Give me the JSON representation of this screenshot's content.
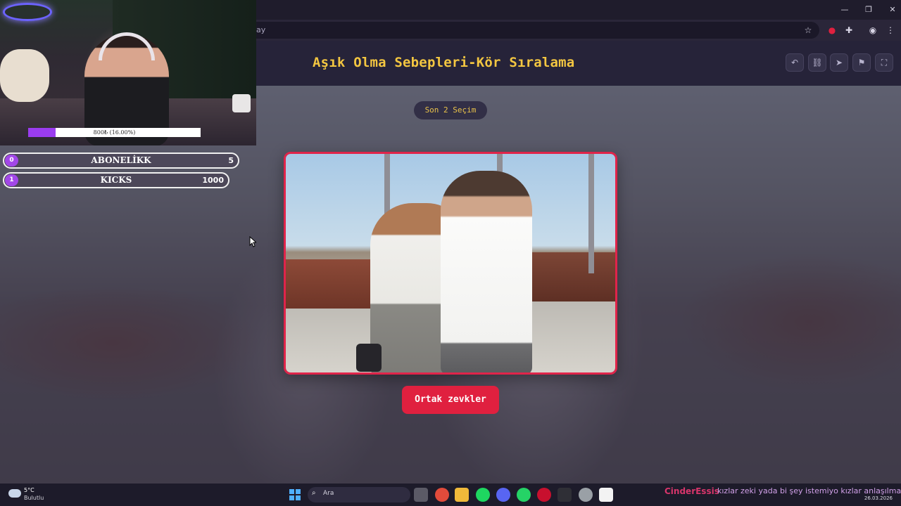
{
  "browser": {
    "url_fragment": "ay",
    "window_controls": [
      "minimize",
      "maximize",
      "close"
    ]
  },
  "app": {
    "title": "Aşık Olma Sebepleri-Kör Sıralama",
    "last_choices_label": "Son 2 Seçim",
    "choice_button_label": "Ortak zevkler",
    "header_buttons": [
      "undo-icon",
      "link-icon",
      "send-icon",
      "flag-icon",
      "fullscreen-icon"
    ],
    "accent_color": "#e0203f",
    "title_color": "#f3c641"
  },
  "stream": {
    "goal_text": "800₺ (16.00%)",
    "goal_progress": 0.16,
    "counters": [
      {
        "badge": "0",
        "label": "ABONELİKK",
        "value": "5"
      },
      {
        "badge": "1",
        "label": "KICKS",
        "value": "1000"
      }
    ]
  },
  "taskbar": {
    "weather_temp": "5°C",
    "weather_desc": "Bulutlu",
    "search_placeholder": "Ara",
    "chat_user": "CinderEssis",
    "chat_message": "kızlar zeki yada bi şey istemiyo kızlar anlaşılmak",
    "date": "26.03.2026"
  }
}
